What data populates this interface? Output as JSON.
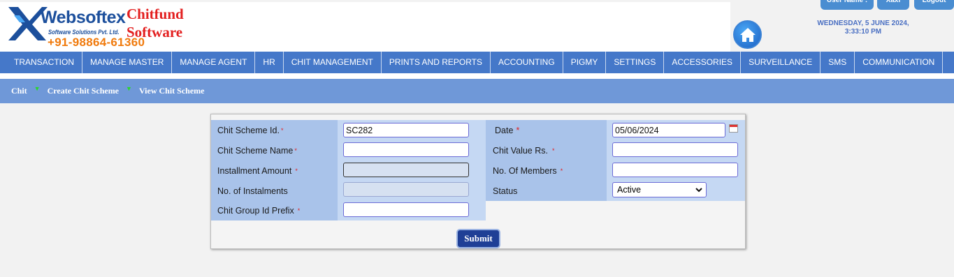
{
  "header": {
    "brand_name": "Websoftex",
    "brand_sub": "Software Solutions Pvt. Ltd.",
    "brand_phone": "+91-98864-61360",
    "app_title_line1": "Chitfund",
    "app_title_line2": "Software",
    "date": "WEDNESDAY, 5 JUNE 2024,",
    "time": "3:33:10 PM",
    "top_buttons": [
      "User Name :",
      "Xaxi",
      "Logout"
    ]
  },
  "menu": {
    "items": [
      "TRANSACTION",
      "MANAGE MASTER",
      "MANAGE AGENT",
      "HR",
      "CHIT MANAGEMENT",
      "PRINTS AND REPORTS",
      "ACCOUNTING",
      "PIGMY",
      "SETTINGS",
      "ACCESSORIES",
      "SURVEILLANCE",
      "SMS",
      "COMMUNICATION"
    ]
  },
  "breadcrumb": {
    "items": [
      "Chit",
      "Create Chit Scheme",
      "View Chit Scheme"
    ]
  },
  "form": {
    "scheme_id_label": "Chit Scheme Id.",
    "scheme_id_value": "SC282",
    "scheme_name_label": "Chit Scheme Name",
    "scheme_name_value": "",
    "installment_amount_label": "Installment Amount",
    "installment_amount_value": "",
    "no_instalments_label": "No. of Instalments",
    "no_instalments_value": "",
    "group_prefix_label": "Chit Group Id Prefix",
    "group_prefix_value": "",
    "date_label": "Date",
    "date_value": "05/06/2024",
    "chit_value_label": "Chit Value Rs.",
    "chit_value_value": "",
    "no_members_label": "No. Of Members",
    "no_members_value": "",
    "status_label": "Status",
    "status_value": "Active",
    "required_mark": "*",
    "submit_label": "Submit"
  },
  "colors": {
    "menu_bg": "#4578c9",
    "breadcrumb_bg": "#6f98d8",
    "label_bg": "#a9c3ea",
    "submit_bg": "#1f3f96",
    "required": "#e31f1f"
  }
}
